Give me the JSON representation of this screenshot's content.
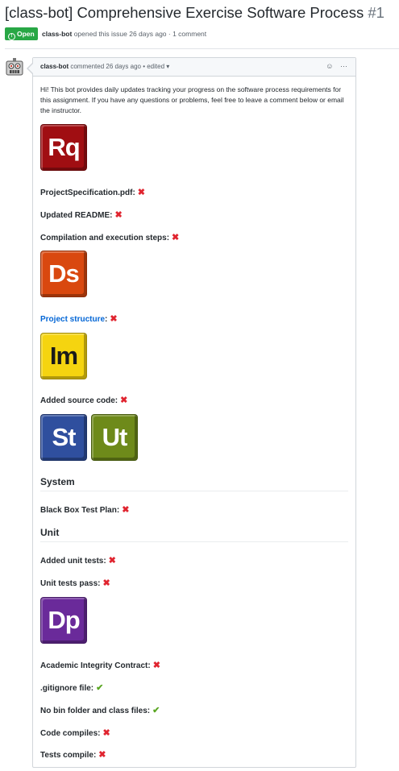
{
  "issue": {
    "title": "[class-bot] Comprehensive Exercise Software Process",
    "number": "#1",
    "state": "Open",
    "state_icon": "!",
    "author": "class-bot",
    "opened_text": "opened this issue 26 days ago · 1 comment"
  },
  "comment": {
    "author": "class-bot",
    "meta": "commented 26 days ago • edited ▾",
    "reaction_icon": "☺",
    "more_icon": "···",
    "intro": "Hi! This bot provides daily updates tracking your progress on the software process requirements for this assignment. If you have any questions or problems, feel free to leave a comment below or email the instructor."
  },
  "badges": {
    "rq": {
      "label": "Rq",
      "bg": "#a00e12",
      "fg": "#ffffff"
    },
    "ds": {
      "label": "Ds",
      "bg": "#d9480f",
      "fg": "#ffffff"
    },
    "im": {
      "label": "Im",
      "bg": "#f5d410",
      "fg": "#1a1a1a"
    },
    "st": {
      "label": "St",
      "bg": "#2f4f9e",
      "fg": "#ffffff"
    },
    "ut": {
      "label": "Ut",
      "bg": "#6e8a1a",
      "fg": "#ffffff"
    },
    "dp": {
      "label": "Dp",
      "bg": "#6a2a9a",
      "fg": "#ffffff"
    }
  },
  "items": {
    "project_spec": {
      "label": "ProjectSpecification.pdf:",
      "mark": "✖"
    },
    "readme": {
      "label": "Updated README:",
      "mark": "✖"
    },
    "compilation": {
      "label": "Compilation and execution steps:",
      "mark": "✖"
    },
    "project_structure": {
      "label": "Project structure",
      "suffix": ":",
      "mark": "✖"
    },
    "source_code": {
      "label": "Added source code:",
      "mark": "✖"
    },
    "black_box": {
      "label": "Black Box Test Plan:",
      "mark": "✖"
    },
    "unit_tests_added": {
      "label": "Added unit tests:",
      "mark": "✖"
    },
    "unit_tests_pass": {
      "label": "Unit tests pass:",
      "mark": "✖"
    },
    "academic": {
      "label": "Academic Integrity Contract:",
      "mark": "✖"
    },
    "gitignore": {
      "label": ".gitignore file:",
      "mark": "✔"
    },
    "no_bin": {
      "label": "No bin folder and class files:",
      "mark": "✔"
    },
    "code_compiles": {
      "label": "Code compiles:",
      "mark": "✖"
    },
    "tests_compile": {
      "label": "Tests compile:",
      "mark": "✖"
    }
  },
  "sections": {
    "system": "System",
    "unit": "Unit"
  },
  "colors": {
    "fail": "#e0242f",
    "pass": "#5aa623",
    "open": "#28a745",
    "link": "#0366d6"
  }
}
